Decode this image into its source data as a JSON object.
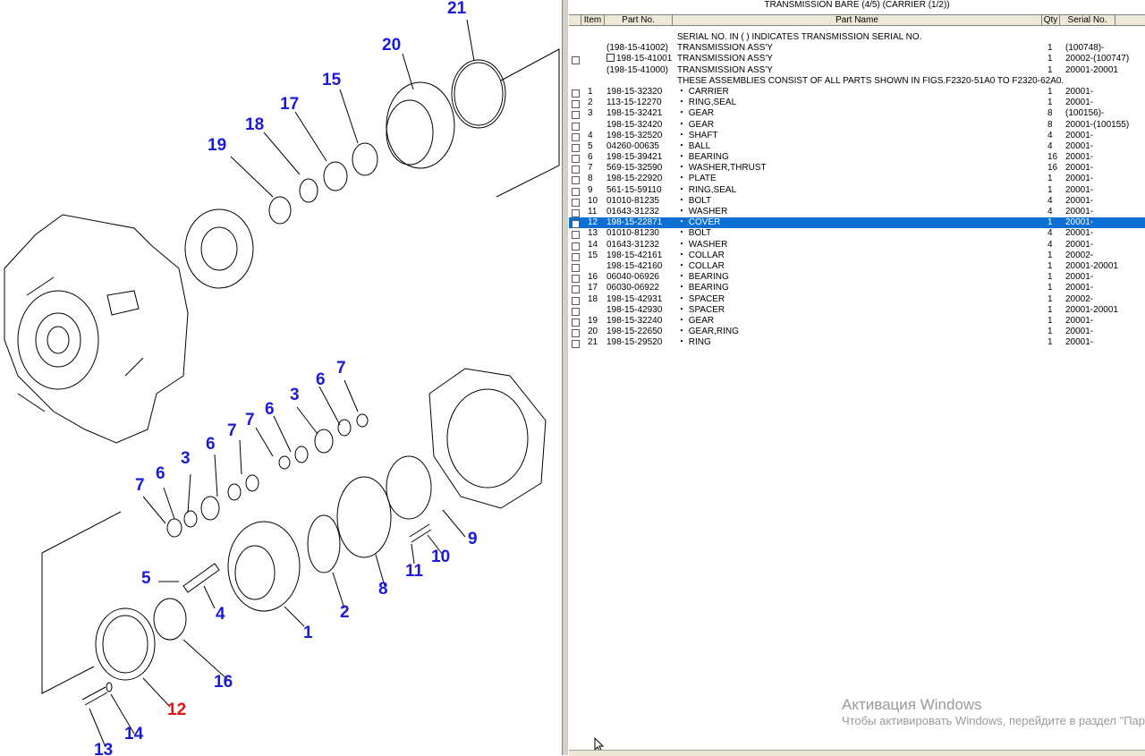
{
  "window": {
    "title": "TRANSMISSION BARE (4/5) (CARRIER (1/2))"
  },
  "columns": {
    "item": "Item",
    "part_no": "Part No.",
    "part_name": "Part Name",
    "qty": "Qty",
    "serial_no": "Serial No."
  },
  "notes": {
    "serial_note": "SERIAL NO. IN ( ) INDICATES TRANSMISSION SERIAL NO.",
    "assembly_note": "THESE ASSEMBLIES CONSIST OF ALL PARTS SHOWN IN FIGS.F2320-51A0 TO F2320-62A0."
  },
  "assemblies": [
    {
      "part": "(198-15-41002)",
      "name": "TRANSMISSION ASS'Y",
      "qty": "1",
      "serial": "(100748)-"
    },
    {
      "part": "198-15-41001",
      "name": "TRANSMISSION ASS'Y",
      "qty": "1",
      "serial": "20002-(100747)"
    },
    {
      "part": "(198-15-41000)",
      "name": "TRANSMISSION ASS'Y",
      "qty": "1",
      "serial": "20001-20001"
    }
  ],
  "parts": [
    {
      "item": "1",
      "part": "198-15-32320",
      "name": "CARRIER",
      "qty": "1",
      "serial": "20001-"
    },
    {
      "item": "2",
      "part": "113-15-12270",
      "name": "RING,SEAL",
      "qty": "1",
      "serial": "20001-"
    },
    {
      "item": "3",
      "part": "198-15-32421",
      "name": "GEAR",
      "qty": "8",
      "serial": "(100156)-"
    },
    {
      "item": "",
      "part": "198-15-32420",
      "name": "GEAR",
      "qty": "8",
      "serial": "20001-(100155)"
    },
    {
      "item": "4",
      "part": "198-15-32520",
      "name": "SHAFT",
      "qty": "4",
      "serial": "20001-"
    },
    {
      "item": "5",
      "part": "04260-00635",
      "name": "BALL",
      "qty": "4",
      "serial": "20001-"
    },
    {
      "item": "6",
      "part": "198-15-39421",
      "name": "BEARING",
      "qty": "16",
      "serial": "20001-"
    },
    {
      "item": "7",
      "part": "569-15-32590",
      "name": "WASHER,THRUST",
      "qty": "16",
      "serial": "20001-"
    },
    {
      "item": "8",
      "part": "198-15-22920",
      "name": "PLATE",
      "qty": "1",
      "serial": "20001-"
    },
    {
      "item": "9",
      "part": "561-15-59110",
      "name": "RING,SEAL",
      "qty": "1",
      "serial": "20001-"
    },
    {
      "item": "10",
      "part": "01010-81235",
      "name": "BOLT",
      "qty": "4",
      "serial": "20001-"
    },
    {
      "item": "11",
      "part": "01643-31232",
      "name": "WASHER",
      "qty": "4",
      "serial": "20001-"
    },
    {
      "item": "12",
      "part": "198-15-22871",
      "name": "COVER",
      "qty": "1",
      "serial": "20001-",
      "selected": true
    },
    {
      "item": "13",
      "part": "01010-81230",
      "name": "BOLT",
      "qty": "4",
      "serial": "20001-"
    },
    {
      "item": "14",
      "part": "01643-31232",
      "name": "WASHER",
      "qty": "4",
      "serial": "20001-"
    },
    {
      "item": "15",
      "part": "198-15-42161",
      "name": "COLLAR",
      "qty": "1",
      "serial": "20002-"
    },
    {
      "item": "",
      "part": "198-15-42160",
      "name": "COLLAR",
      "qty": "1",
      "serial": "20001-20001"
    },
    {
      "item": "16",
      "part": "06040-06926",
      "name": "BEARING",
      "qty": "1",
      "serial": "20001-"
    },
    {
      "item": "17",
      "part": "06030-06922",
      "name": "BEARING",
      "qty": "1",
      "serial": "20001-"
    },
    {
      "item": "18",
      "part": "198-15-42931",
      "name": "SPACER",
      "qty": "1",
      "serial": "20002-"
    },
    {
      "item": "",
      "part": "198-15-42930",
      "name": "SPACER",
      "qty": "1",
      "serial": "20001-20001"
    },
    {
      "item": "19",
      "part": "198-15-32240",
      "name": "GEAR",
      "qty": "1",
      "serial": "20001-"
    },
    {
      "item": "20",
      "part": "198-15-22650",
      "name": "GEAR,RING",
      "qty": "1",
      "serial": "20001-"
    },
    {
      "item": "21",
      "part": "198-15-29520",
      "name": "RING",
      "qty": "1",
      "serial": "20001-"
    }
  ],
  "name_bullet": "・",
  "diagram_callouts": [
    "21",
    "20",
    "15",
    "17",
    "18",
    "19",
    "7",
    "6",
    "3",
    "6",
    "7",
    "7",
    "6",
    "3",
    "6",
    "7",
    "5",
    "4",
    "1",
    "2",
    "8",
    "9",
    "10",
    "11",
    "12",
    "16",
    "13",
    "14"
  ],
  "watermark": {
    "line1": "Активация Windows",
    "line2": "Чтобы активировать Windows, перейдите в раздел \"Пар"
  },
  "colors": {
    "selection": "#0b6fd4",
    "callout": "#1a1adb",
    "callout_selected": "#e01515"
  }
}
